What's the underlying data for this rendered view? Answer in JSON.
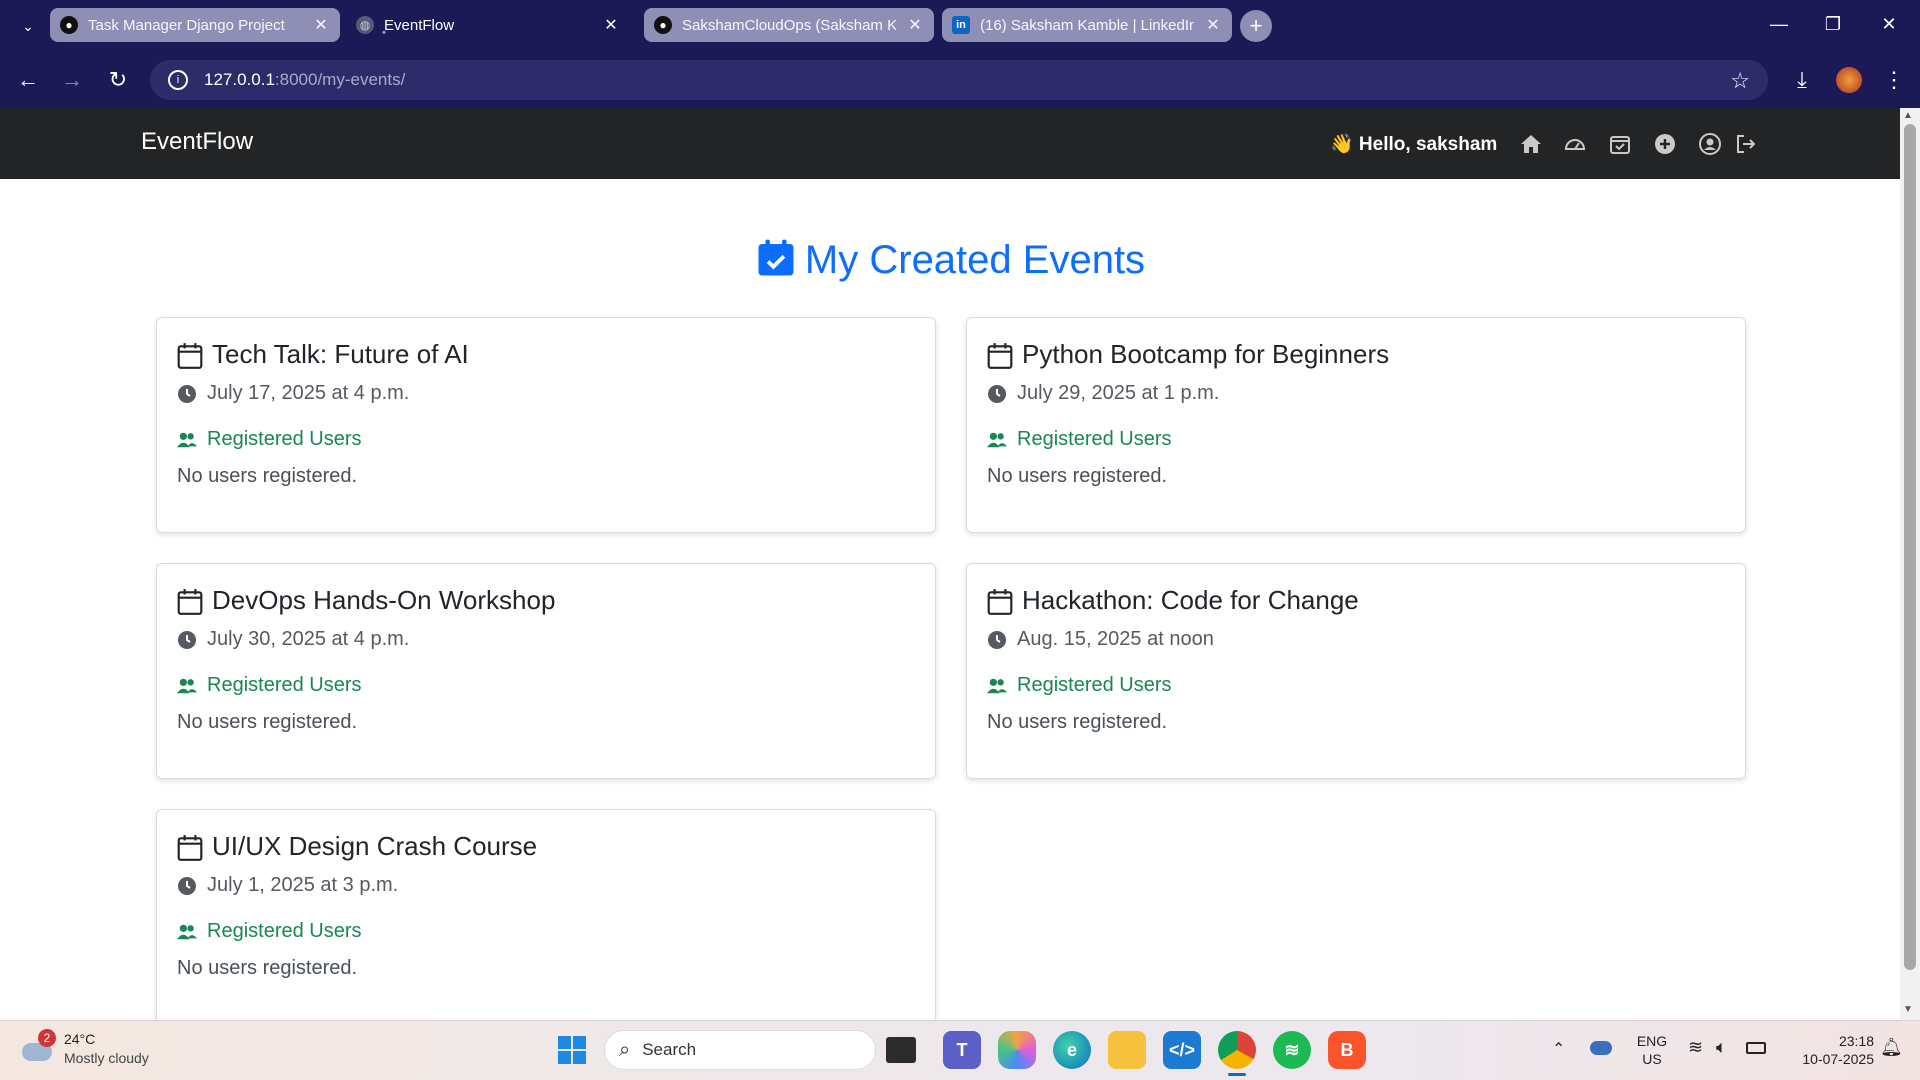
{
  "browser": {
    "tabs": [
      {
        "title": "Task Manager Django Project",
        "active": false
      },
      {
        "title": "EventFlow",
        "active": true
      },
      {
        "title": "SakshamCloudOps (Saksham K",
        "active": false
      },
      {
        "title": "(16) Saksham Kamble | LinkedIn",
        "active": false
      }
    ],
    "url_host": "127.0.0.1",
    "url_path": ":8000/my-events/"
  },
  "header": {
    "brand": "EventFlow",
    "greeting": "👋 Hello, saksham",
    "nav_icons": [
      "home-icon",
      "dashboard-icon",
      "calendar-check-icon",
      "plus-circle-icon",
      "user-circle-icon",
      "logout-icon"
    ]
  },
  "main": {
    "title": "My Created Events",
    "accent": "#0d6efd",
    "events": [
      {
        "title": "Tech Talk: Future of AI",
        "date": "July 17, 2025 at 4 p.m.",
        "registered_label": "Registered Users",
        "registered_empty": "No users registered."
      },
      {
        "title": "Python Bootcamp for Beginners",
        "date": "July 29, 2025 at 1 p.m.",
        "registered_label": "Registered Users",
        "registered_empty": "No users registered."
      },
      {
        "title": "DevOps Hands-On Workshop",
        "date": "July 30, 2025 at 4 p.m.",
        "registered_label": "Registered Users",
        "registered_empty": "No users registered."
      },
      {
        "title": "Hackathon: Code for Change",
        "date": "Aug. 15, 2025 at noon",
        "registered_label": "Registered Users",
        "registered_empty": "No users registered."
      },
      {
        "title": "UI/UX Design Crash Course",
        "date": "July 1, 2025 at 3 p.m.",
        "registered_label": "Registered Users",
        "registered_empty": "No users registered."
      }
    ]
  },
  "taskbar": {
    "weather_temp": "24°C",
    "weather_desc": "Mostly cloudy",
    "weather_badge": "2",
    "search_label": "Search",
    "lang_line1": "ENG",
    "lang_line2": "US",
    "time": "23:18",
    "date": "10-07-2025"
  }
}
